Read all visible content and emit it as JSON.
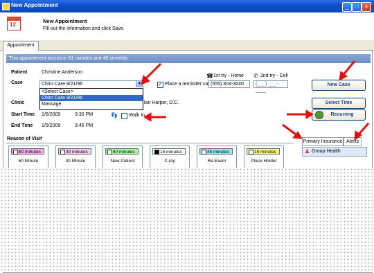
{
  "window": {
    "title": "New Appointment"
  },
  "header": {
    "title": "New Appointment",
    "subtitle": "Fill out the information and click Save.",
    "icon_day": "12"
  },
  "tabs": {
    "appointment": "Appointment"
  },
  "banner": "This appointment occurs in 51 minutes and 40 seconds.",
  "patient": {
    "label": "Patient",
    "value": "Christine Anderson"
  },
  "case": {
    "label": "Case",
    "value": "Chiro Care 9/21/96",
    "options": [
      "<Select Case>",
      "Chiro Care 9/21/96",
      "Massage"
    ]
  },
  "reminder": {
    "label": "Place a reminder call",
    "phone": "(555) 304-3040",
    "phone2_placeholder": "(___) ___-____"
  },
  "tries": {
    "first": "1st try - Home",
    "second": "2nd try - Cell"
  },
  "buttons": {
    "new_case": "New Case",
    "select_time": "Select Time",
    "recurring": "Recurring"
  },
  "clinic": {
    "label": "Clinic",
    "provider_partial": "lan Harper, D.C."
  },
  "start": {
    "label": "Start Time",
    "date": "1/5/2009",
    "time": "3:30 PM"
  },
  "end": {
    "label": "End Time",
    "date": "1/5/2009",
    "time": "3:45 PM"
  },
  "walkin": {
    "label": "Walk In"
  },
  "reason": {
    "label": "Reason of Visit",
    "items": [
      {
        "duration": "60 minutes",
        "name": "60 Minute",
        "color": "#f7a8f0"
      },
      {
        "duration": "30 minutes",
        "name": "30 Minute",
        "color": "#f6c8f2"
      },
      {
        "duration": "60 minutes",
        "name": "New Patient",
        "color": "#a6f7a0"
      },
      {
        "duration": "15 minutes",
        "name": "X-ray",
        "color": "#000000"
      },
      {
        "duration": "45 minutes",
        "name": "Re-Exam",
        "color": "#8fe8f5"
      },
      {
        "duration": "15 minutes",
        "name": "Place Holder",
        "color": "#f5f58a"
      }
    ]
  },
  "side_tabs": {
    "primary_insurance": "Primary Insurance",
    "alerts": "Alerts"
  },
  "insurance": {
    "name": "Group Health"
  },
  "colors": {
    "accent": "#316ac5",
    "arrow": "#e01010"
  }
}
